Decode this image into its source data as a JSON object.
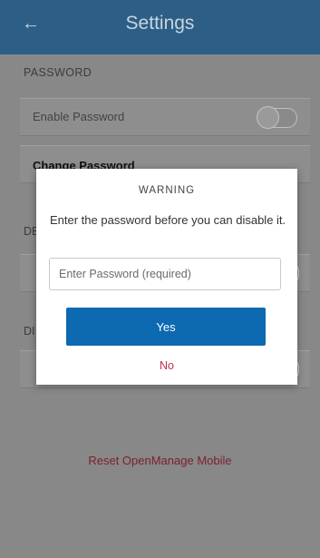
{
  "header": {
    "title": "Settings",
    "back_icon": "arrow-left-icon"
  },
  "password_section": {
    "label": "PASSWORD",
    "enable_label": "Enable Password",
    "enable_checked": false,
    "change_label": "Change Password"
  },
  "hidden_fragments": {
    "section2_prefix": "DE",
    "section3_prefix": "DI"
  },
  "reset_label": "Reset OpenManage Mobile",
  "dialog": {
    "title": "WARNING",
    "message": "Enter the password before you can disable it.",
    "input_placeholder": "Enter Password (required)",
    "input_value": "",
    "yes_label": "Yes",
    "no_label": "No"
  },
  "colors": {
    "app_bar": "#2d5f86",
    "primary_button": "#0d69b0",
    "destructive_text": "#c0304a"
  }
}
